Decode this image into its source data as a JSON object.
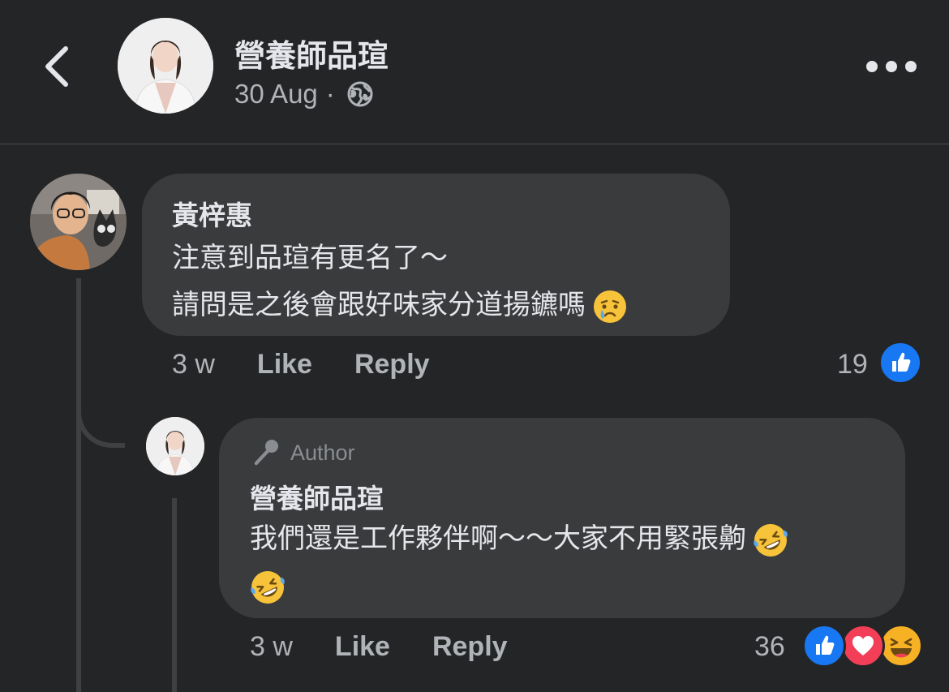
{
  "header": {
    "page_name": "營養師品瑄",
    "post_date": "30 Aug",
    "separator": "·",
    "privacy_icon": "globe-icon",
    "back_icon": "chevron-left-icon",
    "more_icon": "more-horizontal-icon"
  },
  "comments": [
    {
      "author": "黃梓惠",
      "text_lines": [
        "注意到品瑄有更名了～",
        "請問是之後會跟好味家分道揚鑣嗎"
      ],
      "trailing_emoji": "crying-face-emoji",
      "time": "3 w",
      "like_label": "Like",
      "reply_label": "Reply",
      "reaction_count": "19",
      "reactions": [
        "like"
      ]
    }
  ],
  "reply": {
    "badge_icon": "microphone-icon",
    "badge_label": "Author",
    "author": "營養師品瑄",
    "text_lines": [
      "我們還是工作夥伴啊～～大家不用緊張齁"
    ],
    "trailing_emoji": "rolling-on-floor-laughing-emoji",
    "second_line_emoji": "rolling-on-floor-laughing-emoji",
    "time": "3 w",
    "like_label": "Like",
    "reply_label": "Reply",
    "reaction_count": "36",
    "reactions": [
      "like",
      "love",
      "haha"
    ]
  },
  "colors": {
    "background": "#242526",
    "bubble": "#3a3b3c",
    "primary_text": "#e4e6eb",
    "secondary_text": "#b0b3b8",
    "like_blue": "#1877f2",
    "love_red": "#f33e58",
    "haha_yellow": "#f7b125"
  }
}
